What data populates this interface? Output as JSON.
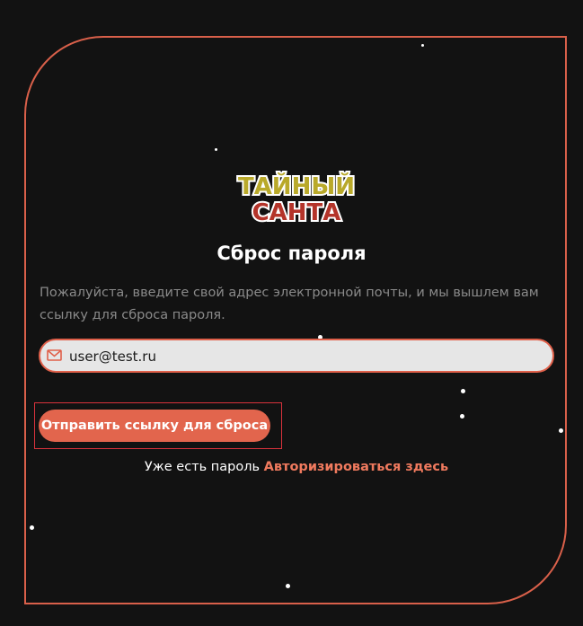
{
  "logo": {
    "line1": "ТАЙНЫЙ",
    "line2": "САНТА",
    "colors": [
      "#b9a92a",
      "#b4342a",
      "#2f6b2f"
    ]
  },
  "form": {
    "title": "Сброс пароля",
    "description": "Пожалуйста, введите свой адрес электронной почты, и мы вышлем вам ссылку для сброса пароля.",
    "email_value": "user@test.ru",
    "email_icon": "mail-icon",
    "submit_label": "Отправить ссылку для сброса"
  },
  "footer": {
    "prompt": "Уже есть пароль",
    "login_link": "Авторизироваться здесь"
  },
  "theme": {
    "background": "#121212",
    "accent": "#e2654d",
    "border": "#d9604a"
  }
}
